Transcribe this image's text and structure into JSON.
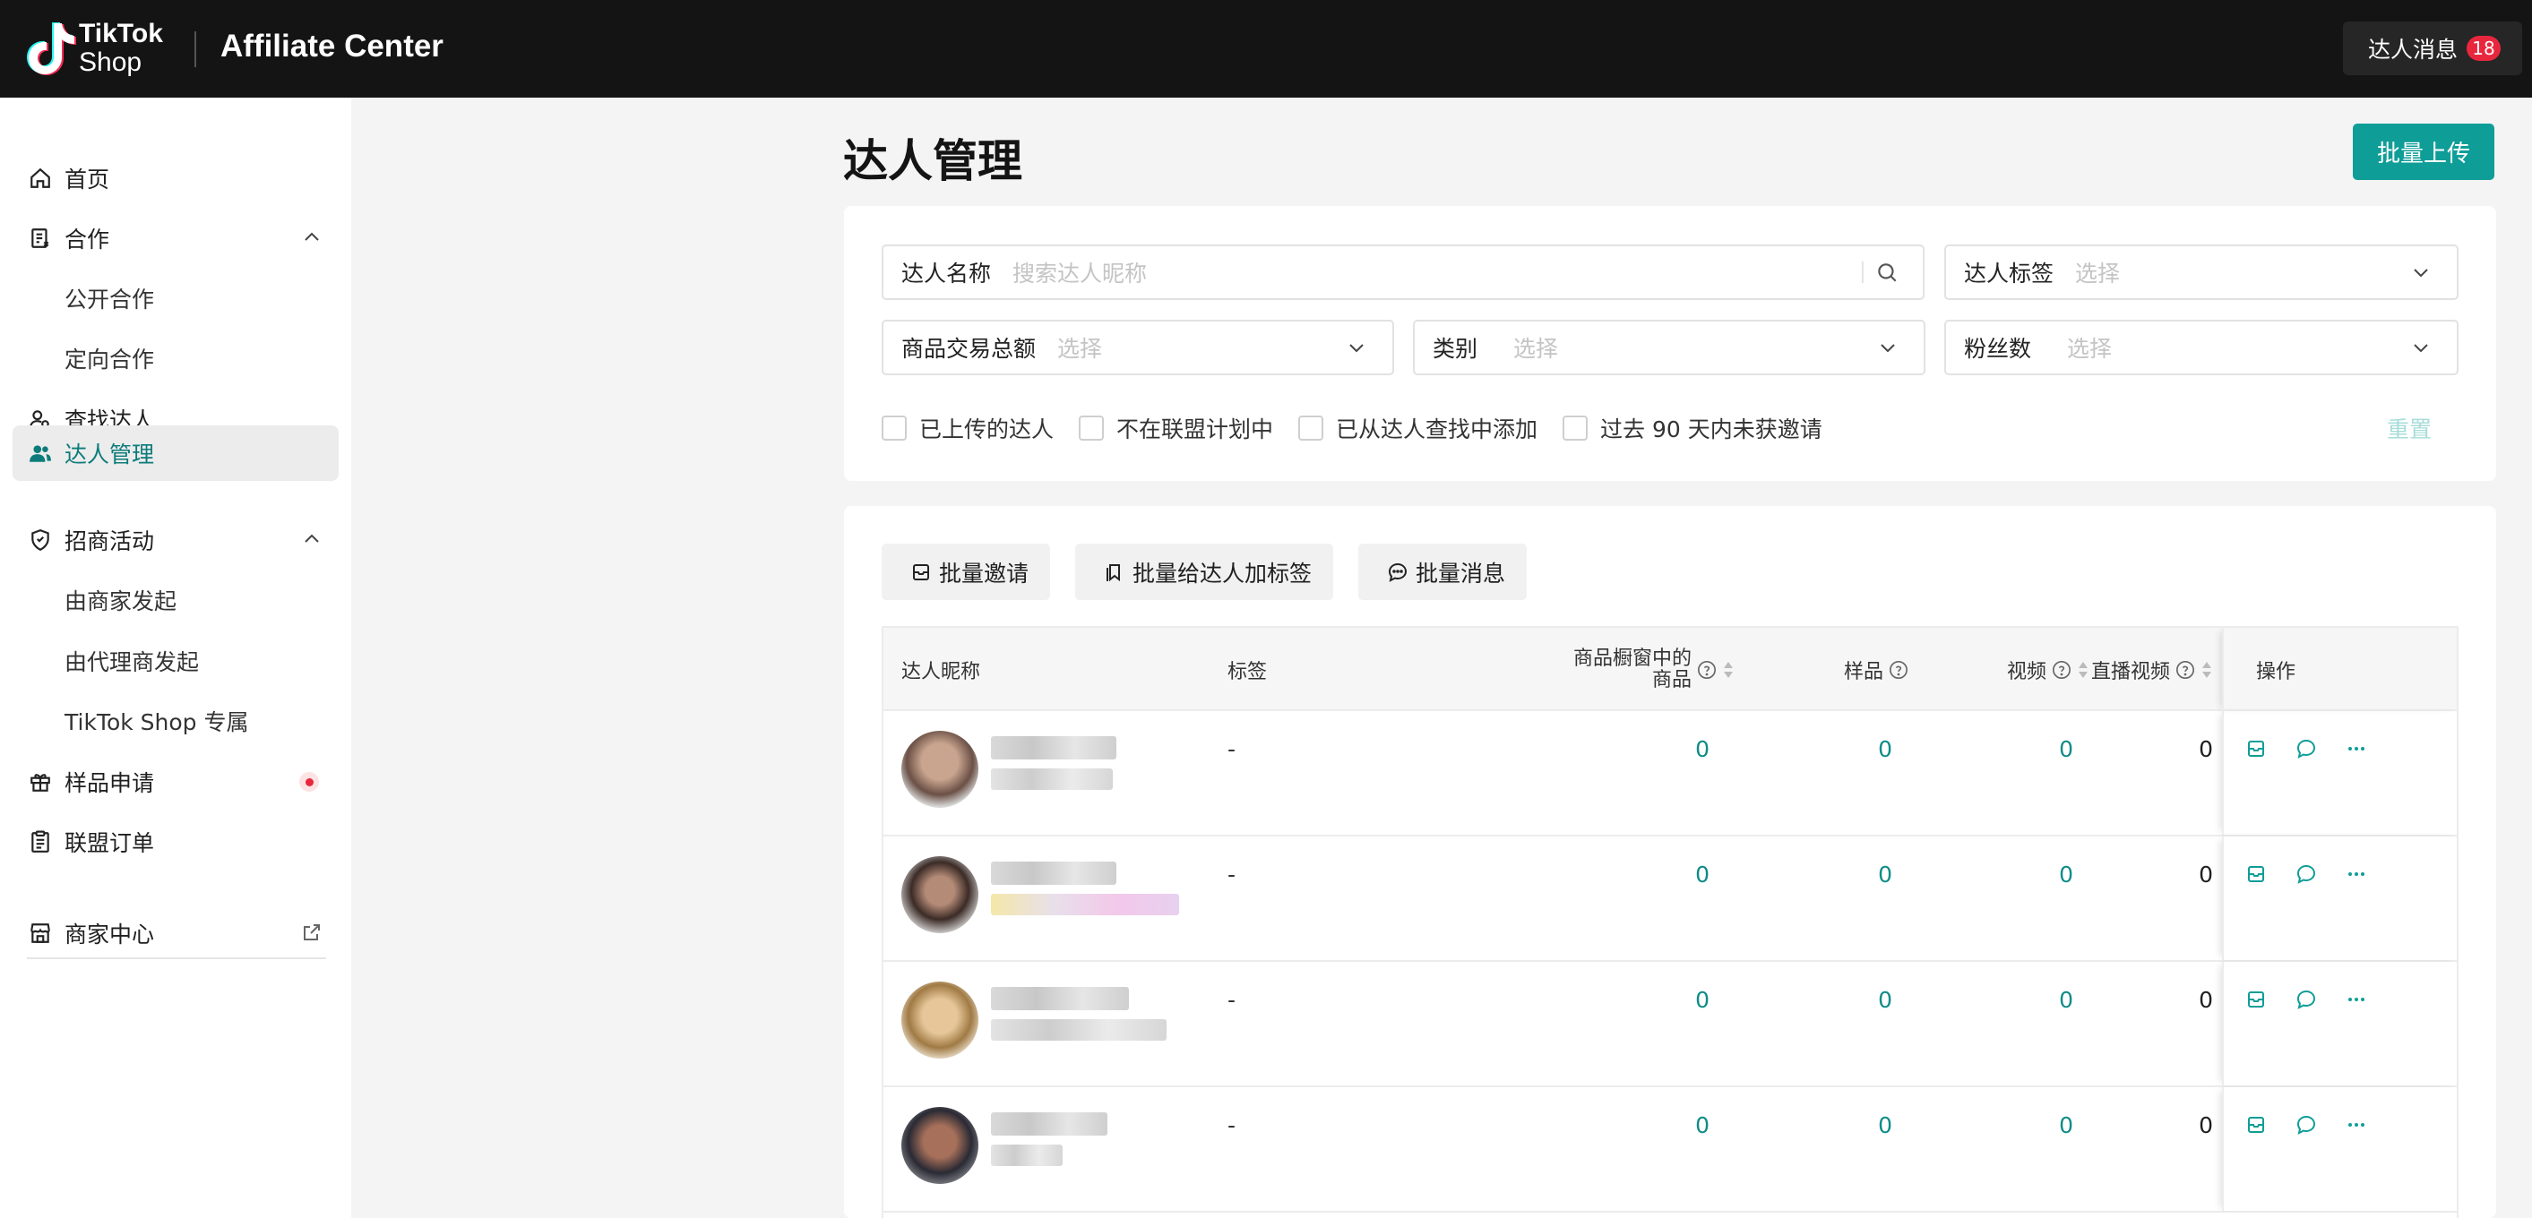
{
  "header": {
    "logo_line1": "TikTok",
    "logo_line2": "Shop",
    "app_title": "Affiliate Center",
    "messages_label": "达人消息",
    "messages_count": "18"
  },
  "sidebar": {
    "items": [
      {
        "label": "首页",
        "icon": "home-icon"
      },
      {
        "label": "合作",
        "icon": "clipboard-icon"
      },
      {
        "label": "公开合作"
      },
      {
        "label": "定向合作"
      },
      {
        "label": "查找达人",
        "icon": "user-search-icon"
      },
      {
        "label": "达人管理",
        "icon": "users-icon",
        "active": true
      },
      {
        "label": "招商活动",
        "icon": "shield-icon"
      },
      {
        "label": "由商家发起"
      },
      {
        "label": "由代理商发起"
      },
      {
        "label": "TikTok Shop 专属"
      },
      {
        "label": "样品申请",
        "icon": "gift-icon"
      },
      {
        "label": "联盟订单",
        "icon": "order-icon"
      },
      {
        "label": "商家中心",
        "icon": "store-icon"
      }
    ]
  },
  "page": {
    "title": "达人管理",
    "upload_button": "批量上传"
  },
  "filters": {
    "creator_name": {
      "label": "达人名称",
      "placeholder": "搜索达人昵称"
    },
    "creator_tag": {
      "label": "达人标签",
      "placeholder": "选择"
    },
    "gmv": {
      "label": "商品交易总额",
      "placeholder": "选择"
    },
    "category": {
      "label": "类别",
      "placeholder": "选择"
    },
    "followers": {
      "label": "粉丝数",
      "placeholder": "选择"
    },
    "checkboxes": [
      "已上传的达人",
      "不在联盟计划中",
      "已从达人查找中添加",
      "过去 90 天内未获邀请"
    ],
    "reset": "重置"
  },
  "toolbar": {
    "invite": "批量邀请",
    "add_tag": "批量给达人加标签",
    "message": "批量消息"
  },
  "table": {
    "columns": {
      "nickname": "达人昵称",
      "tag": "标签",
      "showcase_line1": "商品橱窗中的",
      "showcase_line2": "商品",
      "samples": "样品",
      "videos": "视频",
      "live": "直播视频",
      "actions": "操作"
    },
    "rows": [
      {
        "tag": "-",
        "showcase": "0",
        "samples": "0",
        "videos": "0",
        "live": "0"
      },
      {
        "tag": "-",
        "showcase": "0",
        "samples": "0",
        "videos": "0",
        "live": "0"
      },
      {
        "tag": "-",
        "showcase": "0",
        "samples": "0",
        "videos": "0",
        "live": "0"
      },
      {
        "tag": "-",
        "showcase": "0",
        "samples": "0",
        "videos": "0",
        "live": "0"
      }
    ]
  },
  "colors": {
    "brand": "#0f9d98",
    "topbar": "#141414",
    "badge": "#e8273d"
  }
}
